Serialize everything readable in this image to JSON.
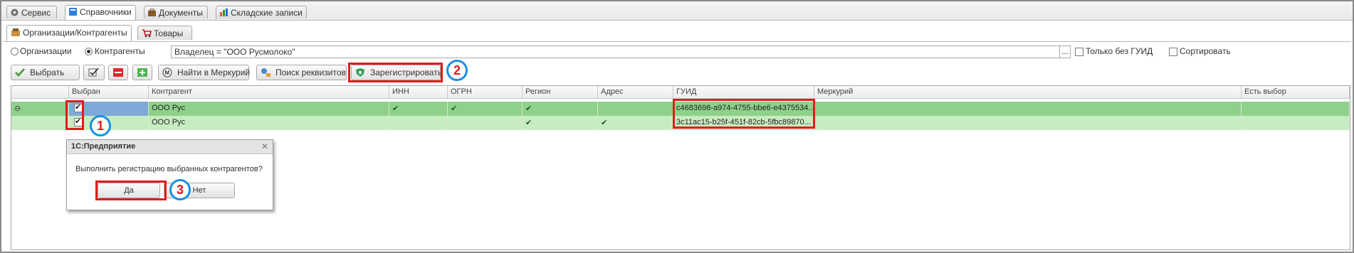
{
  "top_tabs": [
    {
      "label": "Сервис",
      "icon": "gear-icon"
    },
    {
      "label": "Справочники",
      "icon": "book-icon"
    },
    {
      "label": "Документы",
      "icon": "briefcase-icon"
    },
    {
      "label": "Складские записи",
      "icon": "chart-icon"
    }
  ],
  "sub_tabs": [
    {
      "label": "Организации/Контрагенты",
      "icon": "organizations-icon"
    },
    {
      "label": "Товары",
      "icon": "cart-icon"
    }
  ],
  "filter": {
    "radio_organizations": "Организации",
    "radio_counterparties": "Контрагенты",
    "owner_value": "Владелец = \"ООО Русмолоко\"",
    "browse_label": "...",
    "only_without_guid": "Только без ГУИД",
    "sort": "Сортировать"
  },
  "toolbar": {
    "select_label": "Выбрать",
    "find_mercury_label": "Найти в Меркурий",
    "search_requisites_label": "Поиск реквизитов",
    "register_label": "Зарегистрировать"
  },
  "table": {
    "columns": [
      "",
      "Выбран",
      "Контрагент",
      "ИНН",
      "ОГРН",
      "Регион",
      "Адрес",
      "ГУИД",
      "Меркурий",
      "Есть выбор"
    ],
    "rows": [
      {
        "expander": "⊖",
        "selected": true,
        "counterparty": "ООО Рус",
        "inn": "✔",
        "ogrn": "✔",
        "region": "✔",
        "address": "",
        "guid": "c4683698-a974-4755-bbe6-e4375534...",
        "mercury": "",
        "has_choice": ""
      },
      {
        "expander": "",
        "selected": true,
        "counterparty": "ООО Рус",
        "inn": "",
        "ogrn": "",
        "region": "✔",
        "address": "✔",
        "guid": "3c11ac15-b25f-451f-82cb-5fbc89870...",
        "mercury": "",
        "has_choice": ""
      }
    ]
  },
  "dialog": {
    "title": "1С:Предприятие",
    "close": "✕",
    "message": "Выполнить регистрацию выбранных контрагентов?",
    "yes": "Да",
    "no": "Нет"
  },
  "annotations": {
    "step1": "1",
    "step2": "2",
    "step3": "3"
  },
  "colors": {
    "row_selected": "#8fd18a",
    "row": "#c8ecc2",
    "annotation_red": "#e01c1c",
    "annotation_blue": "#1a8fe0"
  }
}
